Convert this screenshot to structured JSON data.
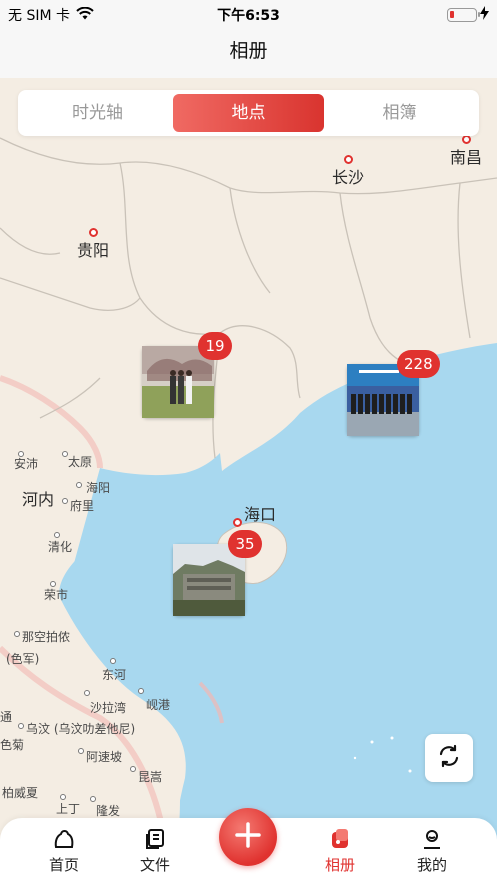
{
  "status_bar": {
    "carrier": "无 SIM 卡",
    "time": "下午6:53",
    "battery_level": 0.15
  },
  "nav": {
    "title": "相册"
  },
  "segments": [
    {
      "label": "时光轴",
      "active": false
    },
    {
      "label": "地点",
      "active": true
    },
    {
      "label": "相簿",
      "active": false
    }
  ],
  "map": {
    "cities": {
      "nanchang": "南昌",
      "changsha": "长沙",
      "guiyang": "贵阳",
      "haikou": "海口",
      "hanoi": "河内"
    },
    "small_labels": {
      "anpei": "安沛",
      "taiyuan": "太原",
      "haiyang": "海阳",
      "fuli": "府里",
      "qinghua": "清化",
      "rongshi": "荣市",
      "nabangpaiyi": "那空拍侬",
      "sejun": "(色军)",
      "donghe": "东河",
      "shabaowan": "沙拉湾",
      "xiangang": "岘港",
      "wuwen": "乌汶 (乌汶叻差他尼)",
      "asuopo": "阿速坡",
      "sejuzhen": "色菊",
      "kunsong": "昆嵩",
      "boweixia": "柏威夏",
      "shangding": "上丁",
      "longfa": "隆发",
      "tong": "通"
    },
    "clusters": [
      {
        "id": "guangxi",
        "count": "19"
      },
      {
        "id": "guangdong",
        "count": "228"
      },
      {
        "id": "hainan",
        "count": "35"
      }
    ]
  },
  "tabbar": {
    "tabs": [
      {
        "label": "首页",
        "icon": "home-icon"
      },
      {
        "label": "文件",
        "icon": "files-icon"
      },
      {
        "label": "相册",
        "icon": "album-icon",
        "active": true
      },
      {
        "label": "我的",
        "icon": "profile-icon"
      }
    ],
    "add_icon": "plus-icon"
  },
  "colors": {
    "accent": "#e0322f",
    "sea": "#a8d8ef",
    "land": "#f4ede3"
  }
}
